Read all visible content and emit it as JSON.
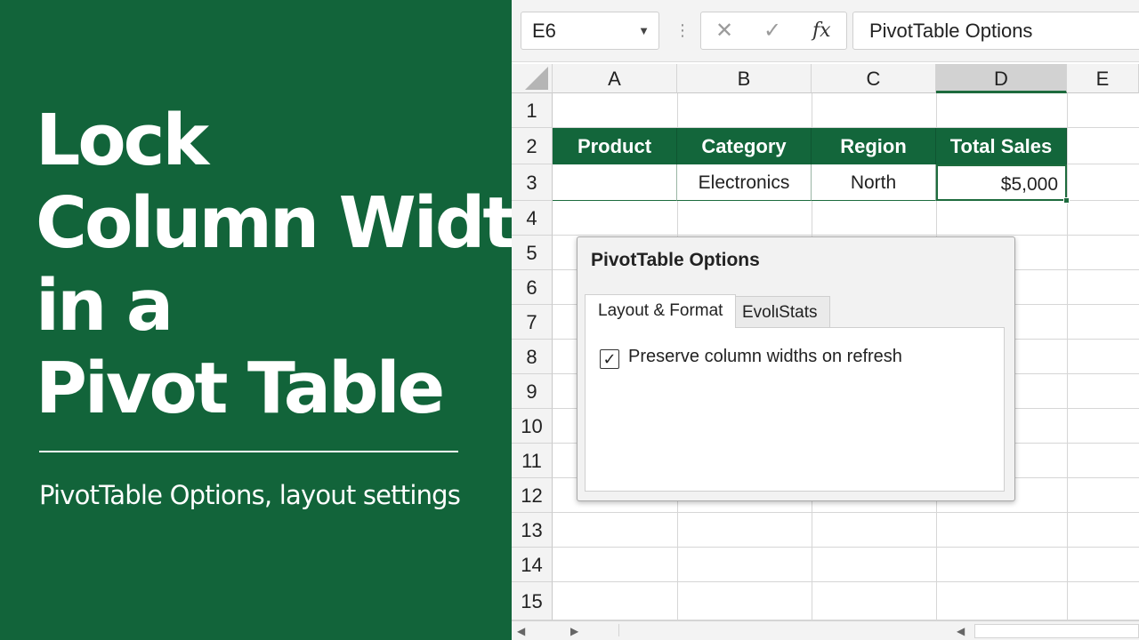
{
  "hero": {
    "title_lines": [
      "Lock",
      "Column Width",
      "in a",
      "Pivot Table"
    ],
    "subtitle": "PivotTable Options, layout settings"
  },
  "formula_bar": {
    "name_box": "E6",
    "formula_text": "PivotTable Options",
    "cancel_glyph": "✕",
    "enter_glyph": "✓",
    "fx_glyph": "fx"
  },
  "grid": {
    "columns": [
      "A",
      "B",
      "C",
      "D",
      "E"
    ],
    "rows": [
      "1",
      "2",
      "3",
      "4",
      "5",
      "6",
      "7",
      "8",
      "9",
      "10",
      "11",
      "12",
      "13",
      "14",
      "15"
    ],
    "selected_column": "D"
  },
  "table": {
    "headers": [
      "Product",
      "Category",
      "Region",
      "Total Sales"
    ],
    "row": [
      "",
      "Electronics",
      "North",
      "$5,000"
    ]
  },
  "dialog": {
    "title": "PivotTable Options",
    "tabs": [
      "Layout & Format",
      "EvolιStats"
    ],
    "checkbox_label": "Preserve column widths on refresh",
    "checkbox_checked": true
  },
  "colors": {
    "excel_green": "#12643a",
    "header_green": "#13663b"
  }
}
